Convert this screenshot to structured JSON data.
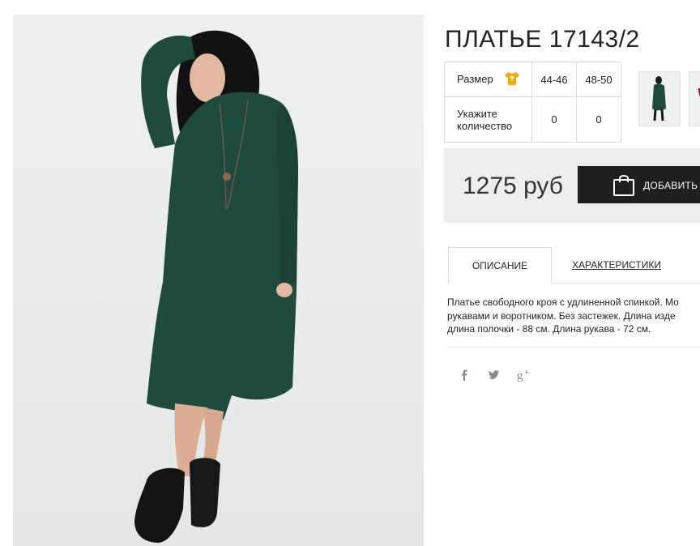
{
  "product": {
    "title": "ПЛАТЬЕ 17143/2"
  },
  "size_table": {
    "size_label": "Размер",
    "qty_label_line1": "Укажите",
    "qty_label_line2": "количество",
    "sizes": [
      "44-46",
      "48-50"
    ],
    "quantities": [
      "0",
      "0"
    ]
  },
  "price": {
    "value": "1275 руб",
    "add_button": "ДОБАВИТЬ"
  },
  "tabs": {
    "description": "ОПИСАНИЕ",
    "characteristics": "ХАРАКТЕРИСТИКИ"
  },
  "description": {
    "line1": "Платье свободного кроя с удлиненной спинкой. Мо",
    "line2": "рукавами и воротником. Без застежек. Длина изде",
    "line3": "длина полочки - 88 см. Длина рукава - 72 см."
  },
  "icons": {
    "size_chart": "tshirt-icon",
    "cart": "shopping-bag-icon",
    "social": [
      "facebook-icon",
      "twitter-icon",
      "google-plus-icon"
    ]
  },
  "colors": {
    "dress": "#1f4a3e",
    "size_icon": "#f2a900",
    "button": "#1f1f1f",
    "price_box": "#ededed"
  }
}
